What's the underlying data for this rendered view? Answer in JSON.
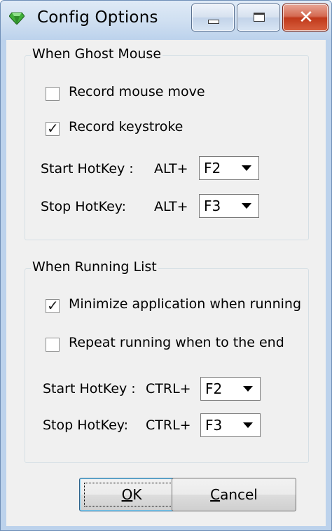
{
  "window": {
    "title": "Config Options",
    "icon": "gem-icon",
    "controls": {
      "minimize": "minimize-icon",
      "maximize": "maximize-icon",
      "close": "close-icon"
    }
  },
  "ghost_mouse": {
    "legend": "When Ghost Mouse",
    "record_mouse_move": {
      "label": "Record mouse move",
      "checked": false
    },
    "record_keystroke": {
      "label": "Record keystroke",
      "checked": true
    },
    "start_hotkey": {
      "label": "Start HotKey :",
      "modifier": "ALT+",
      "value": "F2"
    },
    "stop_hotkey": {
      "label": "Stop HotKey:",
      "modifier": "ALT+",
      "value": "F3"
    }
  },
  "running_list": {
    "legend": "When Running List",
    "minimize_when_running": {
      "label": "Minimize application when running",
      "checked": true
    },
    "repeat_running": {
      "label": "Repeat running  when to the end",
      "checked": false
    },
    "start_hotkey": {
      "label": "Start HotKey :",
      "modifier": "CTRL+",
      "value": "F2"
    },
    "stop_hotkey": {
      "label": "Stop HotKey:",
      "modifier": "CTRL+",
      "value": "F3"
    }
  },
  "buttons": {
    "ok": {
      "label": "OK",
      "accel": "O",
      "rest": "K"
    },
    "cancel": {
      "label": "Cancel",
      "accel": "C",
      "rest": "ancel"
    }
  },
  "colors": {
    "close_button": "#c0391b",
    "title_bar": "#bcd2ec",
    "dialog_bg": "#f0f0f0"
  }
}
